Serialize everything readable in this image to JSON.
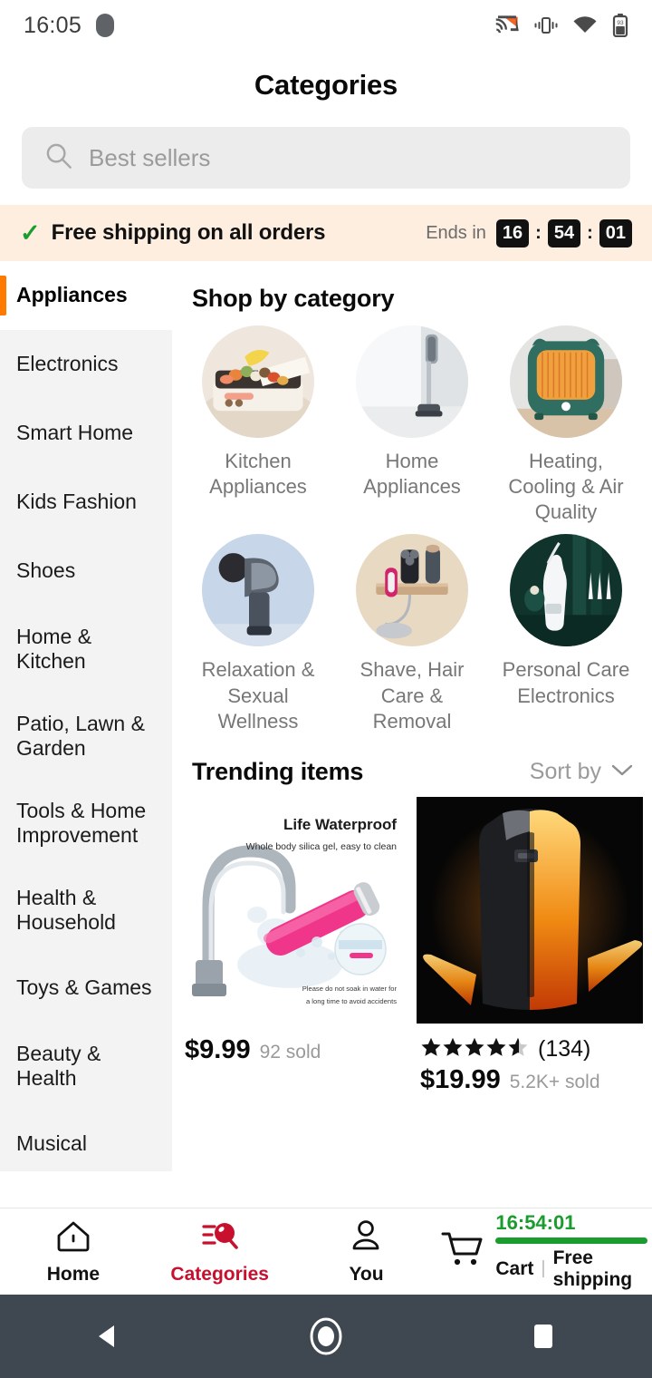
{
  "status_bar": {
    "time": "16:05",
    "icons": [
      "screen-cast-icon",
      "vibrate-icon",
      "wifi-icon",
      "battery-icon"
    ]
  },
  "header": {
    "title": "Categories"
  },
  "search": {
    "placeholder": "Best sellers",
    "value": "",
    "icon": "search-icon"
  },
  "promo_banner": {
    "check_icon": "check-icon",
    "message": "Free shipping on all orders",
    "ends_in_label": "Ends in",
    "countdown": {
      "hours": "16",
      "minutes": "54",
      "seconds": "01",
      "separator": ":"
    },
    "background": "#fdeee0"
  },
  "sidebar": {
    "active_index": 0,
    "accent": "#ff7a00",
    "items": [
      {
        "label": "Appliances",
        "active": true
      },
      {
        "label": "Electronics",
        "active": false
      },
      {
        "label": "Smart Home",
        "active": false
      },
      {
        "label": "Kids Fashion",
        "active": false
      },
      {
        "label": "Shoes",
        "active": false
      },
      {
        "label": "Home & Kitchen",
        "active": false
      },
      {
        "label": "Patio, Lawn & Garden",
        "active": false
      },
      {
        "label": "Tools & Home Improvement",
        "active": false
      },
      {
        "label": "Health & Household",
        "active": false
      },
      {
        "label": "Toys & Games",
        "active": false
      },
      {
        "label": "Beauty & Health",
        "active": false
      },
      {
        "label": "Musical",
        "active": false
      }
    ]
  },
  "main": {
    "shop_by_category": {
      "title": "Shop by category",
      "items": [
        {
          "label": "Kitchen Appliances",
          "image": "electric-griddle-with-food"
        },
        {
          "label": "Home Appliances",
          "image": "cordless-stick-vacuum"
        },
        {
          "label": "Heating, Cooling & Air Quality",
          "image": "green-space-heater"
        },
        {
          "label": "Relaxation & Sexual Wellness",
          "image": "massage-gun"
        },
        {
          "label": "Shave, Hair Care & Removal",
          "image": "shavers-on-wall-rack"
        },
        {
          "label": "Personal Care Electronics",
          "image": "water-flosser"
        }
      ]
    },
    "trending": {
      "title": "Trending items",
      "sort": {
        "label": "Sort by",
        "icon": "chevron-down-icon"
      },
      "products": [
        {
          "image": "pink-waterproof-massager-under-faucet",
          "image_overlay": {
            "headline": "Life Waterproof",
            "subhead": "Whole body silica gel, easy to clean",
            "footnote": "Please do not soak in water for a long time to avoid accidents"
          },
          "price": "$9.99",
          "sold": "92 sold",
          "rating": null,
          "reviews": null
        },
        {
          "image": "black-heated-vest-with-flames",
          "price": "$19.99",
          "sold": "5.2K+ sold",
          "rating": 4.5,
          "stars_display": "★★★★",
          "half_star": true,
          "reviews": "(134)"
        }
      ]
    }
  },
  "bottom_nav": {
    "active": "Categories",
    "active_color": "#c8102e",
    "items": [
      {
        "label": "Home",
        "icon": "home-icon",
        "active": false
      },
      {
        "label": "Categories",
        "icon": "categories-search-icon",
        "active": true
      },
      {
        "label": "You",
        "icon": "person-icon",
        "active": false
      }
    ],
    "cart": {
      "icon": "shopping-cart-icon",
      "label": "Cart",
      "divider": "|",
      "free_shipping": "Free shipping",
      "timer": "16:54:01",
      "timer_color": "#1a9c2e"
    }
  },
  "system_nav": {
    "background": "#3f4750",
    "buttons": [
      {
        "name": "back-button",
        "icon": "triangle-left-icon"
      },
      {
        "name": "home-button",
        "icon": "circle-icon"
      },
      {
        "name": "recents-button",
        "icon": "square-icon"
      }
    ]
  }
}
